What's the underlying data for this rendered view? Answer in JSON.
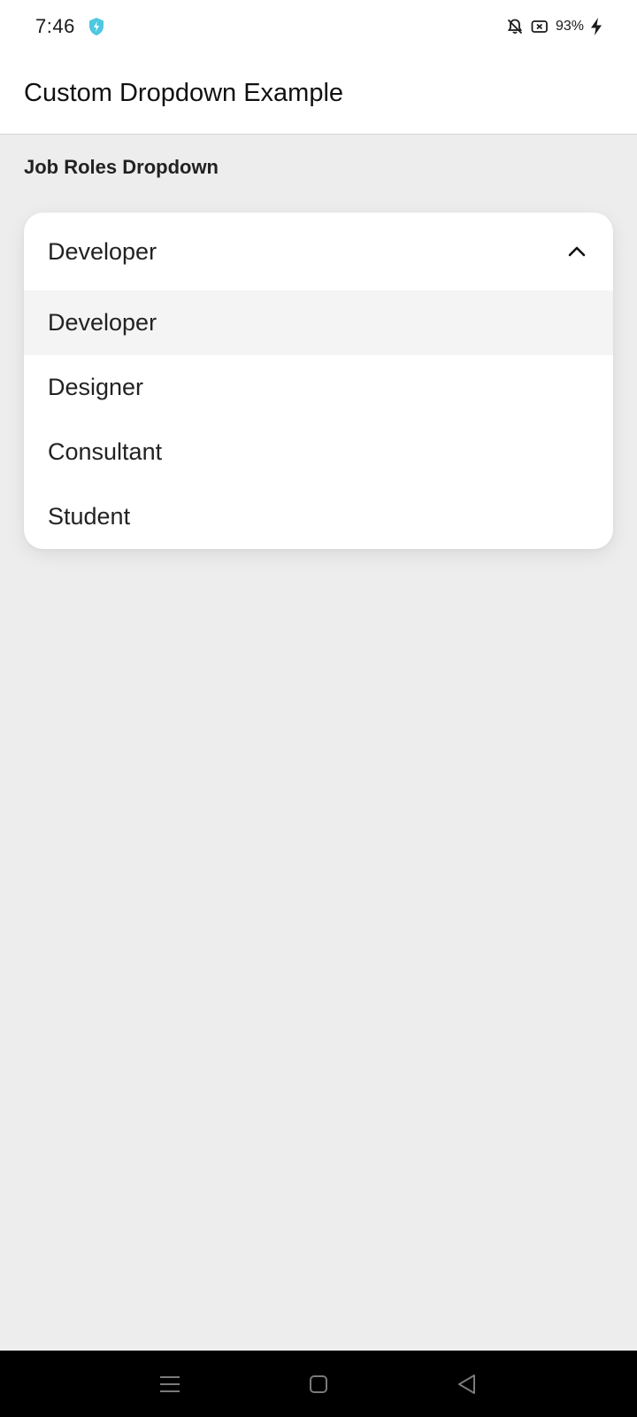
{
  "status_bar": {
    "time": "7:46",
    "battery": "93%",
    "icons": [
      "shield-bolt-icon",
      "bell-off-icon",
      "battery-saver-icon",
      "charging-bolt-icon"
    ]
  },
  "app_bar": {
    "title": "Custom Dropdown Example"
  },
  "section": {
    "label": "Job Roles Dropdown"
  },
  "dropdown": {
    "selected": "Developer",
    "expanded": true,
    "options": [
      {
        "label": "Developer",
        "active": true
      },
      {
        "label": "Designer",
        "active": false
      },
      {
        "label": "Consultant",
        "active": false
      },
      {
        "label": "Student",
        "active": false
      }
    ]
  },
  "nav_bar": {
    "icons": [
      "menu-icon",
      "home-icon",
      "back-icon"
    ]
  },
  "colors": {
    "accent": "#4dc8e0",
    "background": "#ededed",
    "surface": "#ffffff",
    "nav": "#000000"
  }
}
